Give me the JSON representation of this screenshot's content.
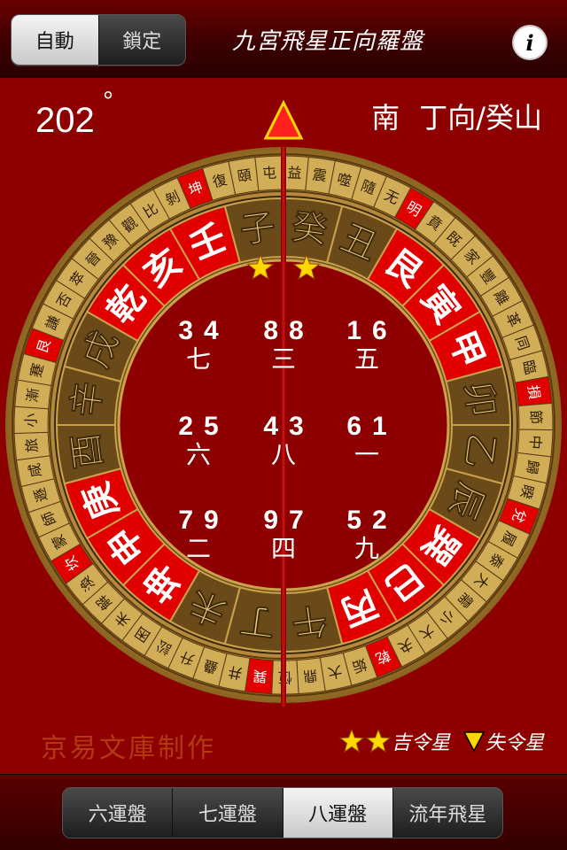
{
  "header": {
    "mode_segments": [
      {
        "label": "自動",
        "selected": true
      },
      {
        "label": "鎖定",
        "selected": false
      }
    ],
    "title": "九宮飛星正向羅盤",
    "info_icon": "info-icon",
    "info_glyph": "i"
  },
  "reading": {
    "degree": "202",
    "degree_mark": "°",
    "direction": "南",
    "facing_mountain": "丁向/癸山"
  },
  "compass": {
    "pointer_icon": "pointer-triangle-icon",
    "inner_ring": [
      {
        "char": "丁",
        "red": false
      },
      {
        "char": "未",
        "red": false
      },
      {
        "char": "坤",
        "red": true
      },
      {
        "char": "申",
        "red": true
      },
      {
        "char": "庚",
        "red": true
      },
      {
        "char": "酉",
        "red": false
      },
      {
        "char": "辛",
        "red": false
      },
      {
        "char": "戌",
        "red": false
      },
      {
        "char": "乾",
        "red": true
      },
      {
        "char": "亥",
        "red": true
      },
      {
        "char": "壬",
        "red": true
      },
      {
        "char": "子",
        "red": false
      },
      {
        "char": "癸",
        "red": false
      },
      {
        "char": "丑",
        "red": false
      },
      {
        "char": "艮",
        "red": true
      },
      {
        "char": "寅",
        "red": true
      },
      {
        "char": "甲",
        "red": true
      },
      {
        "char": "卯",
        "red": false
      },
      {
        "char": "乙",
        "red": false
      },
      {
        "char": "辰",
        "red": false
      },
      {
        "char": "巽",
        "red": true
      },
      {
        "char": "巳",
        "red": true
      },
      {
        "char": "丙",
        "red": true
      },
      {
        "char": "午",
        "red": false
      }
    ],
    "outer_ring": [
      "巽",
      "井",
      "蠱",
      "升",
      "訟",
      "困",
      "未",
      "解",
      "渙",
      "坎",
      "蒙",
      "師",
      "遯",
      "咸",
      "旅",
      "小",
      "漸",
      "蹇",
      "艮",
      "謙",
      "否",
      "萃",
      "晉",
      "豫",
      "觀",
      "比",
      "剝",
      "坤",
      "復",
      "頤",
      "屯",
      "益",
      "震",
      "噬",
      "隨",
      "无",
      "明",
      "賁",
      "既",
      "家",
      "豐",
      "離",
      "革",
      "同",
      "臨",
      "損",
      "節",
      "中",
      "歸",
      "睽",
      "兌",
      "履",
      "泰",
      "大",
      "需",
      "小",
      "大",
      "夬",
      "乾",
      "姤",
      "大",
      "鼎",
      "恆"
    ],
    "outer_ring_red": [
      0,
      9,
      18,
      27,
      36,
      45,
      50,
      58
    ],
    "good_star_marker_count": 2
  },
  "flying_stars": [
    {
      "mountain": "3",
      "facing": "4",
      "period": "七"
    },
    {
      "mountain": "8",
      "facing": "8",
      "period": "三"
    },
    {
      "mountain": "1",
      "facing": "6",
      "period": "五"
    },
    {
      "mountain": "2",
      "facing": "5",
      "period": "六"
    },
    {
      "mountain": "4",
      "facing": "3",
      "period": "八"
    },
    {
      "mountain": "6",
      "facing": "1",
      "period": "一"
    },
    {
      "mountain": "7",
      "facing": "9",
      "period": "二"
    },
    {
      "mountain": "9",
      "facing": "7",
      "period": "四"
    },
    {
      "mountain": "5",
      "facing": "2",
      "period": "九"
    }
  ],
  "footer": {
    "credit": "京易文庫制作",
    "legend_good": "吉令星",
    "legend_bad": "失令星",
    "legend_good_icon": "star-icon",
    "legend_bad_icon": "triangle-down-icon"
  },
  "period_tabs": [
    {
      "label": "六運盤",
      "selected": false
    },
    {
      "label": "七運盤",
      "selected": false
    },
    {
      "label": "八運盤",
      "selected": true
    },
    {
      "label": "流年飛星",
      "selected": false
    }
  ],
  "colors": {
    "background": "#8e0000",
    "gold": "#b38a3c",
    "ring_brown": "#6b4a1a",
    "red_cell": "#e00000",
    "star_yellow": "#ffd800"
  }
}
